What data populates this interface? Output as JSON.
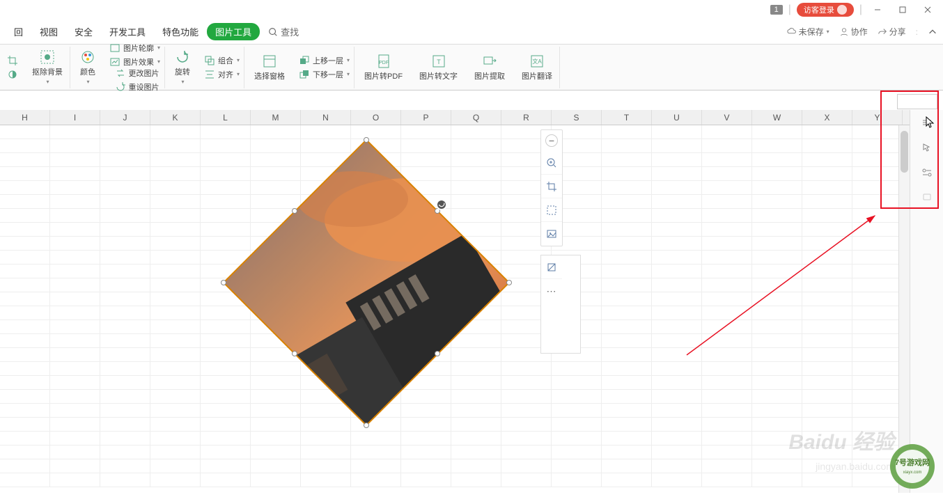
{
  "titlebar": {
    "badge": "1",
    "login": "访客登录"
  },
  "menu": {
    "items": [
      "回",
      "视图",
      "安全",
      "开发工具",
      "特色功能"
    ],
    "active": "图片工具",
    "search": "查找"
  },
  "topRight": {
    "unsaved": "未保存",
    "collab": "协作",
    "share": "分享"
  },
  "ribbon": {
    "cropBg": "抠除背景",
    "color": "颜色",
    "outline": "图片轮廓",
    "changeImg": "更改图片",
    "effect": "图片效果",
    "resetImg": "重设图片",
    "rotate": "旋转",
    "group": "组合",
    "align": "对齐",
    "moveUp": "上移一层",
    "moveDown": "下移一层",
    "selectPane": "选择窗格",
    "toPdf": "图片转PDF",
    "toText": "图片转文字",
    "extract": "图片提取",
    "translate": "图片翻译"
  },
  "columns": [
    "H",
    "I",
    "J",
    "K",
    "L",
    "M",
    "N",
    "O",
    "P",
    "Q",
    "R",
    "S",
    "T",
    "U",
    "V",
    "W",
    "X",
    "Y"
  ],
  "watermark": {
    "brand": "Baidu 经验",
    "url": "jingyan.baidu.com",
    "site": "7号游戏网",
    "siteurl": "xiayx.com"
  }
}
